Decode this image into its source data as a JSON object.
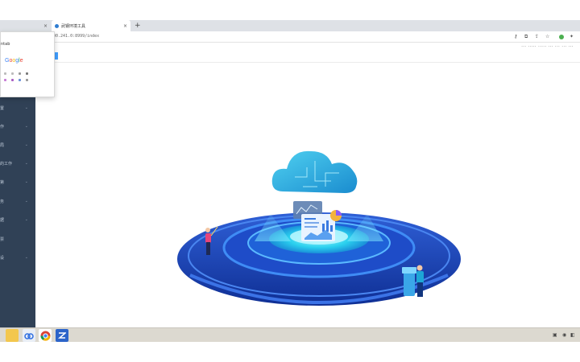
{
  "browser": {
    "tabs": [
      {
        "label": ""
      },
      {
        "label": "武钢环境工具"
      }
    ],
    "new_tab": "+",
    "close": "×",
    "url": "00.241.0:8999/index",
    "toolbar_icons": [
      "key-icon",
      "translate-icon",
      "share-icon",
      "star-icon",
      "extension-icon",
      "puzzle-icon",
      "menu-icon"
    ]
  },
  "popup": {
    "title": "ntab",
    "google_logo": [
      "G",
      "o",
      "o",
      "g",
      "l",
      "e"
    ]
  },
  "header": {
    "right_text": "... ..... ..... ... ... ... ..."
  },
  "sidebar": {
    "items": [
      {
        "label": "置"
      },
      {
        "label": "作"
      },
      {
        "label": "局"
      },
      {
        "label": "的工作"
      },
      {
        "label": "第"
      },
      {
        "label": "务"
      },
      {
        "label": "据"
      },
      {
        "label": "票"
      },
      {
        "label": "设"
      }
    ],
    "chevron": "⌄"
  },
  "taskbar": {
    "apps": [
      "file-explorer-icon",
      "baidu-netdisk-icon",
      "chrome-icon",
      "app-icon"
    ]
  },
  "colors": {
    "sidebar_bg": "#304156",
    "accent": "#409eff",
    "platform_dark": "#1a3fa8",
    "platform_light": "#23c5e8"
  }
}
